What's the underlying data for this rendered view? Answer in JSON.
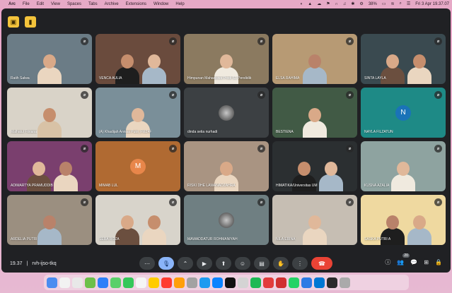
{
  "menubar": {
    "apple": "",
    "items": [
      "Arc",
      "File",
      "Edit",
      "View",
      "Spaces",
      "Tabs",
      "Archive",
      "Extensions",
      "Window",
      "Help"
    ],
    "battery": "38%",
    "datetime": "Fri 3 Apr  19.37.07"
  },
  "participants": [
    {
      "name": "Ratih Salwa",
      "bg": "#6b7c86"
    },
    {
      "name": "VENCA AULIA",
      "bg": "#6a4b3d"
    },
    {
      "name": "Himpunan Mahasiswa Prodi S1 Pendidik",
      "bg": "#8b7a60"
    },
    {
      "name": "ELSA RAHIMA",
      "bg": "#b79a74"
    },
    {
      "name": "SINTA LAYLA",
      "bg": "#3a4a50"
    },
    {
      "name": "Malhatul Fitriana",
      "bg": "#d9d3c8"
    },
    {
      "name": "(A) Khadijah Annisa Putri_FMZ4F",
      "bg": "#7a8f99"
    },
    {
      "name": "dinda setia nurhadi",
      "bg": "#3c4043",
      "photo_avatar": true
    },
    {
      "name": "BESTIENA",
      "bg": "#415a45"
    },
    {
      "name": "NAYLA FILZATUN",
      "bg": "#1e8a86",
      "avatar": "N",
      "avatar_color": "#1a73b8"
    },
    {
      "name": "ADIMARTYA PRAMUDDIB",
      "bg": "#7a3f6e"
    },
    {
      "name": "MIMAB LUL",
      "bg": "#b06a32",
      "avatar": "M",
      "avatar_color": "#e8864a"
    },
    {
      "name": "RISKI DHE LAWANADZAHRA",
      "bg": "#a99482"
    },
    {
      "name": "HIMATIKA/Universitas UM",
      "bg": "#2b2f31"
    },
    {
      "name": "KUSNA AZALIA",
      "bg": "#8ea3a0"
    },
    {
      "name": "ARDELIA PUTRI",
      "bg": "#9b8f80"
    },
    {
      "name": "SERA ROZA",
      "bg": "#d8d4cb"
    },
    {
      "name": "MAWADDATUR ROHMANIYAH",
      "bg": "#6f7f82",
      "photo_avatar": true
    },
    {
      "name": "NILA ERINA",
      "bg": "#c6beb3"
    },
    {
      "name": "SASKA PUTRI A",
      "bg": "#efd9a0"
    }
  ],
  "bottombar": {
    "time": "19.37",
    "separator": "|",
    "meeting_code": "rvh-ijso-tkq",
    "participants_count": "20"
  },
  "dock_colors": [
    "#4a8cf0",
    "#f2f2f2",
    "#e8e8e8",
    "#6cc04a",
    "#2d7ff9",
    "#5ad06a",
    "#34c759",
    "#f5f5f5",
    "#ffcc00",
    "#ff3b30",
    "#ff9f0a",
    "#a2a2a2",
    "#1d9bf0",
    "#0a84ff",
    "#111111",
    "#d4d4d4",
    "#1db954",
    "#e23c3c",
    "#d03030",
    "#25d366",
    "#2c7be5",
    "#0078d4",
    "#2b2b2b",
    "#aaaaaa"
  ]
}
